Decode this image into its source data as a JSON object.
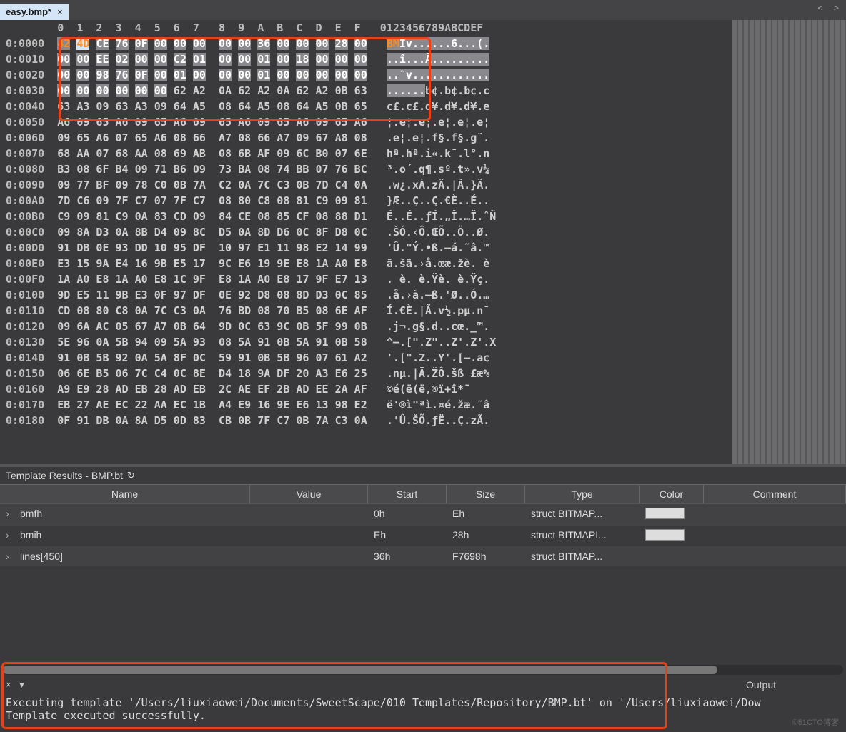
{
  "tab": {
    "label": "easy.bmp*",
    "close": "×"
  },
  "nav_arrows": "<  >",
  "hex": {
    "col_header": "        0  1  2  3  4  5  6  7   8  9  A  B  C  D  E  F   0123456789ABCDEF",
    "rows": [
      {
        "offset": "0:0000",
        "hex": [
          "42",
          "4D",
          "CE",
          "76",
          "0F",
          "00",
          "00",
          "00",
          " ",
          "00",
          "00",
          "36",
          "00",
          "00",
          "00",
          "28",
          "00"
        ],
        "ascii": "BMÎv......6...(.",
        "sel": true,
        "first2": true
      },
      {
        "offset": "0:0010",
        "hex": [
          "00",
          "00",
          "EE",
          "02",
          "00",
          "00",
          "C2",
          "01",
          " ",
          "00",
          "00",
          "01",
          "00",
          "18",
          "00",
          "00",
          "00"
        ],
        "ascii": "..î...Â.........",
        "sel": true
      },
      {
        "offset": "0:0020",
        "hex": [
          "00",
          "00",
          "98",
          "76",
          "0F",
          "00",
          "01",
          "00",
          " ",
          "00",
          "00",
          "01",
          "00",
          "00",
          "00",
          "00",
          "00"
        ],
        "ascii": "..˜v............",
        "sel": true
      },
      {
        "offset": "0:0030",
        "hex": [
          "00",
          "00",
          "00",
          "00",
          "00",
          "00",
          "62",
          "A2",
          " ",
          "0A",
          "62",
          "A2",
          "0A",
          "62",
          "A2",
          "0B",
          "63"
        ],
        "ascii": "......b¢.b¢.b¢.c",
        "partsel": 6
      },
      {
        "offset": "0:0040",
        "hex": [
          "63",
          "A3",
          "09",
          "63",
          "A3",
          "09",
          "64",
          "A5",
          " ",
          "08",
          "64",
          "A5",
          "08",
          "64",
          "A5",
          "0B",
          "65"
        ],
        "ascii": "c£.c£.d¥.d¥.d¥.e"
      },
      {
        "offset": "0:0050",
        "hex": [
          "A6",
          "09",
          "65",
          "A6",
          "09",
          "65",
          "A6",
          "09",
          " ",
          "65",
          "A6",
          "09",
          "65",
          "A6",
          "09",
          "65",
          "A6"
        ],
        "ascii": "¦.e¦.e¦.e¦.e¦.e¦"
      },
      {
        "offset": "0:0060",
        "hex": [
          "09",
          "65",
          "A6",
          "07",
          "65",
          "A6",
          "08",
          "66",
          " ",
          "A7",
          "08",
          "66",
          "A7",
          "09",
          "67",
          "A8",
          "08"
        ],
        "ascii": ".e¦.e¦.f§.f§.g¨."
      },
      {
        "offset": "0:0070",
        "hex": [
          "68",
          "AA",
          "07",
          "68",
          "AA",
          "08",
          "69",
          "AB",
          " ",
          "08",
          "6B",
          "AF",
          "09",
          "6C",
          "B0",
          "07",
          "6E"
        ],
        "ascii": "hª.hª.i«.k¯.l°.n"
      },
      {
        "offset": "0:0080",
        "hex": [
          "B3",
          "08",
          "6F",
          "B4",
          "09",
          "71",
          "B6",
          "09",
          " ",
          "73",
          "BA",
          "08",
          "74",
          "BB",
          "07",
          "76",
          "BC"
        ],
        "ascii": "³.o´.q¶.sº.t».v¼"
      },
      {
        "offset": "0:0090",
        "hex": [
          "09",
          "77",
          "BF",
          "09",
          "78",
          "C0",
          "0B",
          "7A",
          " ",
          "C2",
          "0A",
          "7C",
          "C3",
          "0B",
          "7D",
          "C4",
          "0A"
        ],
        "ascii": ".w¿.xÀ.zÂ.|Ã.}Ä."
      },
      {
        "offset": "0:00A0",
        "hex": [
          "7D",
          "C6",
          "09",
          "7F",
          "C7",
          "07",
          "7F",
          "C7",
          " ",
          "08",
          "80",
          "C8",
          "08",
          "81",
          "C9",
          "09",
          "81"
        ],
        "ascii": "}Æ..Ç..Ç.€È..É.."
      },
      {
        "offset": "0:00B0",
        "hex": [
          "C9",
          "09",
          "81",
          "C9",
          "0A",
          "83",
          "CD",
          "09",
          " ",
          "84",
          "CE",
          "08",
          "85",
          "CF",
          "08",
          "88",
          "D1"
        ],
        "ascii": "É..É..ƒÍ.„Î.…Ï.ˆÑ"
      },
      {
        "offset": "0:00C0",
        "hex": [
          "09",
          "8A",
          "D3",
          "0A",
          "8B",
          "D4",
          "09",
          "8C",
          " ",
          "D5",
          "0A",
          "8D",
          "D6",
          "0C",
          "8F",
          "D8",
          "0C"
        ],
        "ascii": ".ŠÓ.‹Ô.ŒÕ..Ö..Ø."
      },
      {
        "offset": "0:00D0",
        "hex": [
          "91",
          "DB",
          "0E",
          "93",
          "DD",
          "10",
          "95",
          "DF",
          " ",
          "10",
          "97",
          "E1",
          "11",
          "98",
          "E2",
          "14",
          "99"
        ],
        "ascii": "'Û.\"Ý.•ß.—á.˜â.™"
      },
      {
        "offset": "0:00E0",
        "hex": [
          "E3",
          "15",
          "9A",
          "E4",
          "16",
          "9B",
          "E5",
          "17",
          " ",
          "9C",
          "E6",
          "19",
          "9E",
          "E8",
          "1A",
          "A0",
          "E8"
        ],
        "ascii": "ã.šä.›å.œæ.žè. è"
      },
      {
        "offset": "0:00F0",
        "hex": [
          "1A",
          "A0",
          "E8",
          "1A",
          "A0",
          "E8",
          "1C",
          "9F",
          " ",
          "E8",
          "1A",
          "A0",
          "E8",
          "17",
          "9F",
          "E7",
          "13"
        ],
        "ascii": ". è. è.Ÿè. è.Ÿç."
      },
      {
        "offset": "0:0100",
        "hex": [
          "9D",
          "E5",
          "11",
          "9B",
          "E3",
          "0F",
          "97",
          "DF",
          " ",
          "0E",
          "92",
          "D8",
          "08",
          "8D",
          "D3",
          "0C",
          "85"
        ],
        "ascii": ".å.›ã.—ß.'Ø..Ó.…"
      },
      {
        "offset": "0:0110",
        "hex": [
          "CD",
          "08",
          "80",
          "C8",
          "0A",
          "7C",
          "C3",
          "0A",
          " ",
          "76",
          "BD",
          "08",
          "70",
          "B5",
          "08",
          "6E",
          "AF"
        ],
        "ascii": "Í.€È.|Ã.v½.pµ.n¯"
      },
      {
        "offset": "0:0120",
        "hex": [
          "09",
          "6A",
          "AC",
          "05",
          "67",
          "A7",
          "0B",
          "64",
          " ",
          "9D",
          "0C",
          "63",
          "9C",
          "0B",
          "5F",
          "99",
          "0B"
        ],
        "ascii": ".j¬.g§.d..cœ._™."
      },
      {
        "offset": "0:0130",
        "hex": [
          "5E",
          "96",
          "0A",
          "5B",
          "94",
          "09",
          "5A",
          "93",
          " ",
          "08",
          "5A",
          "91",
          "0B",
          "5A",
          "91",
          "0B",
          "58"
        ],
        "ascii": "^–.[\".Z\"..Z'.Z'.X"
      },
      {
        "offset": "0:0140",
        "hex": [
          "91",
          "0B",
          "5B",
          "92",
          "0A",
          "5A",
          "8F",
          "0C",
          " ",
          "59",
          "91",
          "0B",
          "5B",
          "96",
          "07",
          "61",
          "A2"
        ],
        "ascii": "'.[\".Z..Y'.[–.a¢"
      },
      {
        "offset": "0:0150",
        "hex": [
          "06",
          "6E",
          "B5",
          "06",
          "7C",
          "C4",
          "0C",
          "8E",
          " ",
          "D4",
          "18",
          "9A",
          "DF",
          "20",
          "A3",
          "E6",
          "25"
        ],
        "ascii": ".nµ.|Ä.ŽÔ.šß £æ%"
      },
      {
        "offset": "0:0160",
        "hex": [
          "A9",
          "E9",
          "28",
          "AD",
          "EB",
          "28",
          "AD",
          "EB",
          " ",
          "2C",
          "AE",
          "EF",
          "2B",
          "AD",
          "EE",
          "2A",
          "AF"
        ],
        "ascii": "©é(­ë(­ë,®ï+­î*¯"
      },
      {
        "offset": "0:0170",
        "hex": [
          "EB",
          "27",
          "AE",
          "EC",
          "22",
          "AA",
          "EC",
          "1B",
          " ",
          "A4",
          "E9",
          "16",
          "9E",
          "E6",
          "13",
          "98",
          "E2"
        ],
        "ascii": "ë'®ì\"ªì.¤é.žæ.˜â"
      },
      {
        "offset": "0:0180",
        "hex": [
          "0F",
          "91",
          "DB",
          "0A",
          "8A",
          "D5",
          "0D",
          "83",
          " ",
          "CB",
          "0B",
          "7F",
          "C7",
          "0B",
          "7A",
          "C3",
          "0A"
        ],
        "ascii": ".'Û.ŠÕ.ƒË..Ç.zÃ."
      }
    ]
  },
  "template": {
    "title": "Template Results - BMP.bt",
    "refresh": "↻",
    "headers": {
      "name": "Name",
      "value": "Value",
      "start": "Start",
      "size": "Size",
      "type": "Type",
      "color": "Color",
      "comment": "Comment"
    },
    "rows": [
      {
        "name": "bmfh",
        "value": "",
        "start": "0h",
        "size": "Eh",
        "type": "struct BITMAP...",
        "swatch": true
      },
      {
        "name": "bmih",
        "value": "",
        "start": "Eh",
        "size": "28h",
        "type": "struct BITMAPI...",
        "swatch": true
      },
      {
        "name": "lines[450]",
        "value": "",
        "start": "36h",
        "size": "F7698h",
        "type": "struct BITMAP...",
        "swatch": false
      }
    ]
  },
  "output": {
    "controls": "×  ▾",
    "title": "Output",
    "line1": "Executing template '/Users/liuxiaowei/Documents/SweetScape/010 Templates/Repository/BMP.bt' on '/Users/liuxiaowei/Dow",
    "line2": "Template executed successfully."
  },
  "watermark": "©51CTO博客"
}
